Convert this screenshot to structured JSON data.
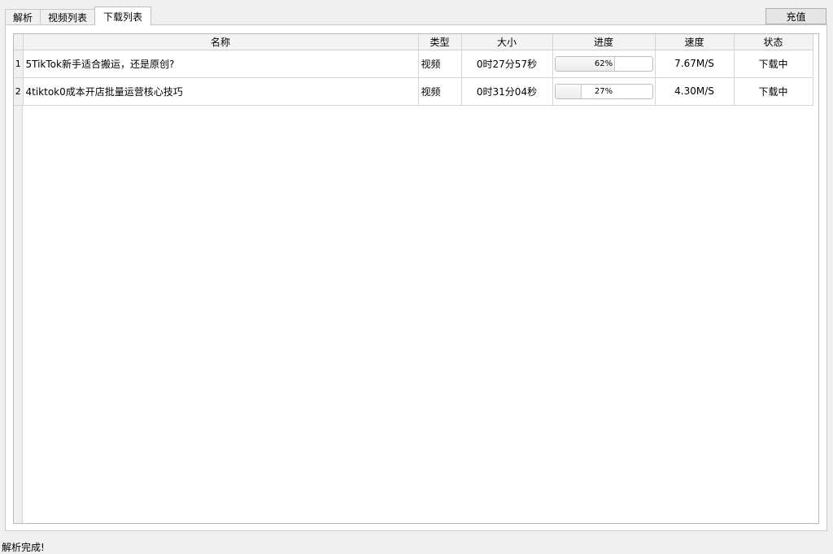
{
  "tabs": [
    {
      "label": "解析",
      "active": false
    },
    {
      "label": "视频列表",
      "active": false
    },
    {
      "label": "下载列表",
      "active": true
    }
  ],
  "toolbar": {
    "recharge_label": "充值"
  },
  "table": {
    "columns": [
      "名称",
      "类型",
      "大小",
      "进度",
      "速度",
      "状态"
    ],
    "rows": [
      {
        "index": "1",
        "name": "5TikTok新手适合搬运，还是原创?",
        "type": "视频",
        "size": "0时27分57秒",
        "progress": 62,
        "progress_label": "62%",
        "speed": "7.67M/S",
        "status": "下载中"
      },
      {
        "index": "2",
        "name": "4tiktok0成本开店批量运营核心技巧",
        "type": "视频",
        "size": "0时31分04秒",
        "progress": 27,
        "progress_label": "27%",
        "speed": "4.30M/S",
        "status": "下载中"
      }
    ]
  },
  "status_bar": {
    "text": "解析完成!"
  }
}
